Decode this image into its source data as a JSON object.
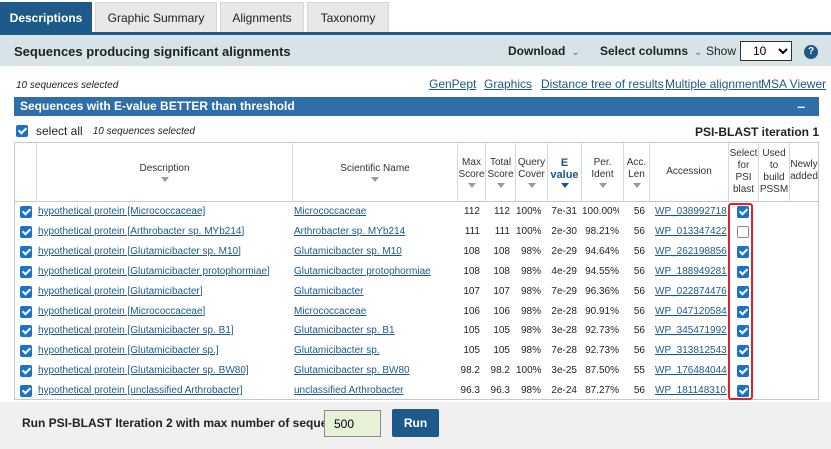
{
  "tabs": [
    "Descriptions",
    "Graphic Summary",
    "Alignments",
    "Taxonomy"
  ],
  "header": {
    "title": "Sequences producing significant alignments",
    "download": "Download",
    "select_columns": "Select columns",
    "show_label": "Show",
    "show_value": "10",
    "help": "?"
  },
  "toolbar": {
    "selected_count": "10 sequences selected",
    "links": [
      "GenPept",
      "Graphics",
      "Distance tree of results",
      "Multiple alignment",
      "MSA Viewer"
    ]
  },
  "evalue_bar": {
    "title": "Sequences with E-value BETTER than threshold",
    "collapse": "–"
  },
  "select_all": {
    "label": "select all",
    "count": "10 sequences selected"
  },
  "iteration": "PSI-BLAST iteration 1",
  "columns": {
    "description": "Description",
    "scientific_name": "Scientific Name",
    "max_score": [
      "Max",
      "Score"
    ],
    "total_score": [
      "Total",
      "Score"
    ],
    "query_cover": [
      "Query",
      "Cover"
    ],
    "evalue": [
      "E",
      "value"
    ],
    "per_ident": [
      "Per.",
      "Ident"
    ],
    "acc_len": [
      "Acc.",
      "Len"
    ],
    "accession": "Accession",
    "select_psi": [
      "Select",
      "for",
      "PSI",
      "blast"
    ],
    "used_pssm": [
      "Used",
      "to",
      "build",
      "PSSM"
    ],
    "newly_added": [
      "Newly",
      "added"
    ]
  },
  "rows": [
    {
      "checked": true,
      "description": "hypothetical protein [Micrococcaceae]",
      "sci": "Micrococcaceae",
      "max": "112",
      "total": "112",
      "cover": "100%",
      "evalue": "7e-31",
      "ident": "100.00%",
      "len": "56",
      "acc": "WP_038992718.1",
      "psi": true
    },
    {
      "checked": true,
      "description": "hypothetical protein [Arthrobacter sp. MYb214]",
      "sci": "Arthrobacter sp. MYb214",
      "max": "111",
      "total": "111",
      "cover": "100%",
      "evalue": "2e-30",
      "ident": "98.21%",
      "len": "56",
      "acc": "WP_013347422.1",
      "psi": false
    },
    {
      "checked": true,
      "description": "hypothetical protein [Glutamicibacter sp. M10]",
      "sci": "Glutamicibacter sp. M10",
      "max": "108",
      "total": "108",
      "cover": "98%",
      "evalue": "2e-29",
      "ident": "94.64%",
      "len": "56",
      "acc": "WP_262198856.1",
      "psi": true
    },
    {
      "checked": true,
      "description": "hypothetical protein [Glutamicibacter protophormiae]",
      "sci": "Glutamicibacter protophormiae",
      "max": "108",
      "total": "108",
      "cover": "98%",
      "evalue": "4e-29",
      "ident": "94.55%",
      "len": "56",
      "acc": "WP_188949281.1",
      "psi": true
    },
    {
      "checked": true,
      "description": "hypothetical protein [Glutamicibacter]",
      "sci": "Glutamicibacter",
      "max": "107",
      "total": "107",
      "cover": "98%",
      "evalue": "7e-29",
      "ident": "96.36%",
      "len": "56",
      "acc": "WP_022874476.1",
      "psi": true
    },
    {
      "checked": true,
      "description": "hypothetical protein [Micrococcaceae]",
      "sci": "Micrococcaceae",
      "max": "106",
      "total": "106",
      "cover": "98%",
      "evalue": "2e-28",
      "ident": "90.91%",
      "len": "56",
      "acc": "WP_047120584.1",
      "psi": true
    },
    {
      "checked": true,
      "description": "hypothetical protein [Glutamicibacter sp. B1]",
      "sci": "Glutamicibacter sp. B1",
      "max": "105",
      "total": "105",
      "cover": "98%",
      "evalue": "3e-28",
      "ident": "92.73%",
      "len": "56",
      "acc": "WP_345471992.1",
      "psi": true
    },
    {
      "checked": true,
      "description": "hypothetical protein [Glutamicibacter sp.]",
      "sci": "Glutamicibacter sp.",
      "max": "105",
      "total": "105",
      "cover": "98%",
      "evalue": "7e-28",
      "ident": "92.73%",
      "len": "56",
      "acc": "WP_313812543.1",
      "psi": true
    },
    {
      "checked": true,
      "description": "hypothetical protein [Glutamicibacter sp. BW80]",
      "sci": "Glutamicibacter sp. BW80",
      "max": "98.2",
      "total": "98.2",
      "cover": "100%",
      "evalue": "3e-25",
      "ident": "87.50%",
      "len": "55",
      "acc": "WP_176484044.1",
      "psi": true
    },
    {
      "checked": true,
      "description": "hypothetical protein [unclassified Arthrobacter]",
      "sci": "unclassified Arthrobacter",
      "max": "96.3",
      "total": "96.3",
      "cover": "98%",
      "evalue": "2e-24",
      "ident": "87.27%",
      "len": "56",
      "acc": "WP_181148310.1",
      "psi": true
    }
  ],
  "footer": {
    "label": "Run PSI-BLAST Iteration 2 with max number of sequences",
    "value": "500",
    "run": "Run"
  }
}
